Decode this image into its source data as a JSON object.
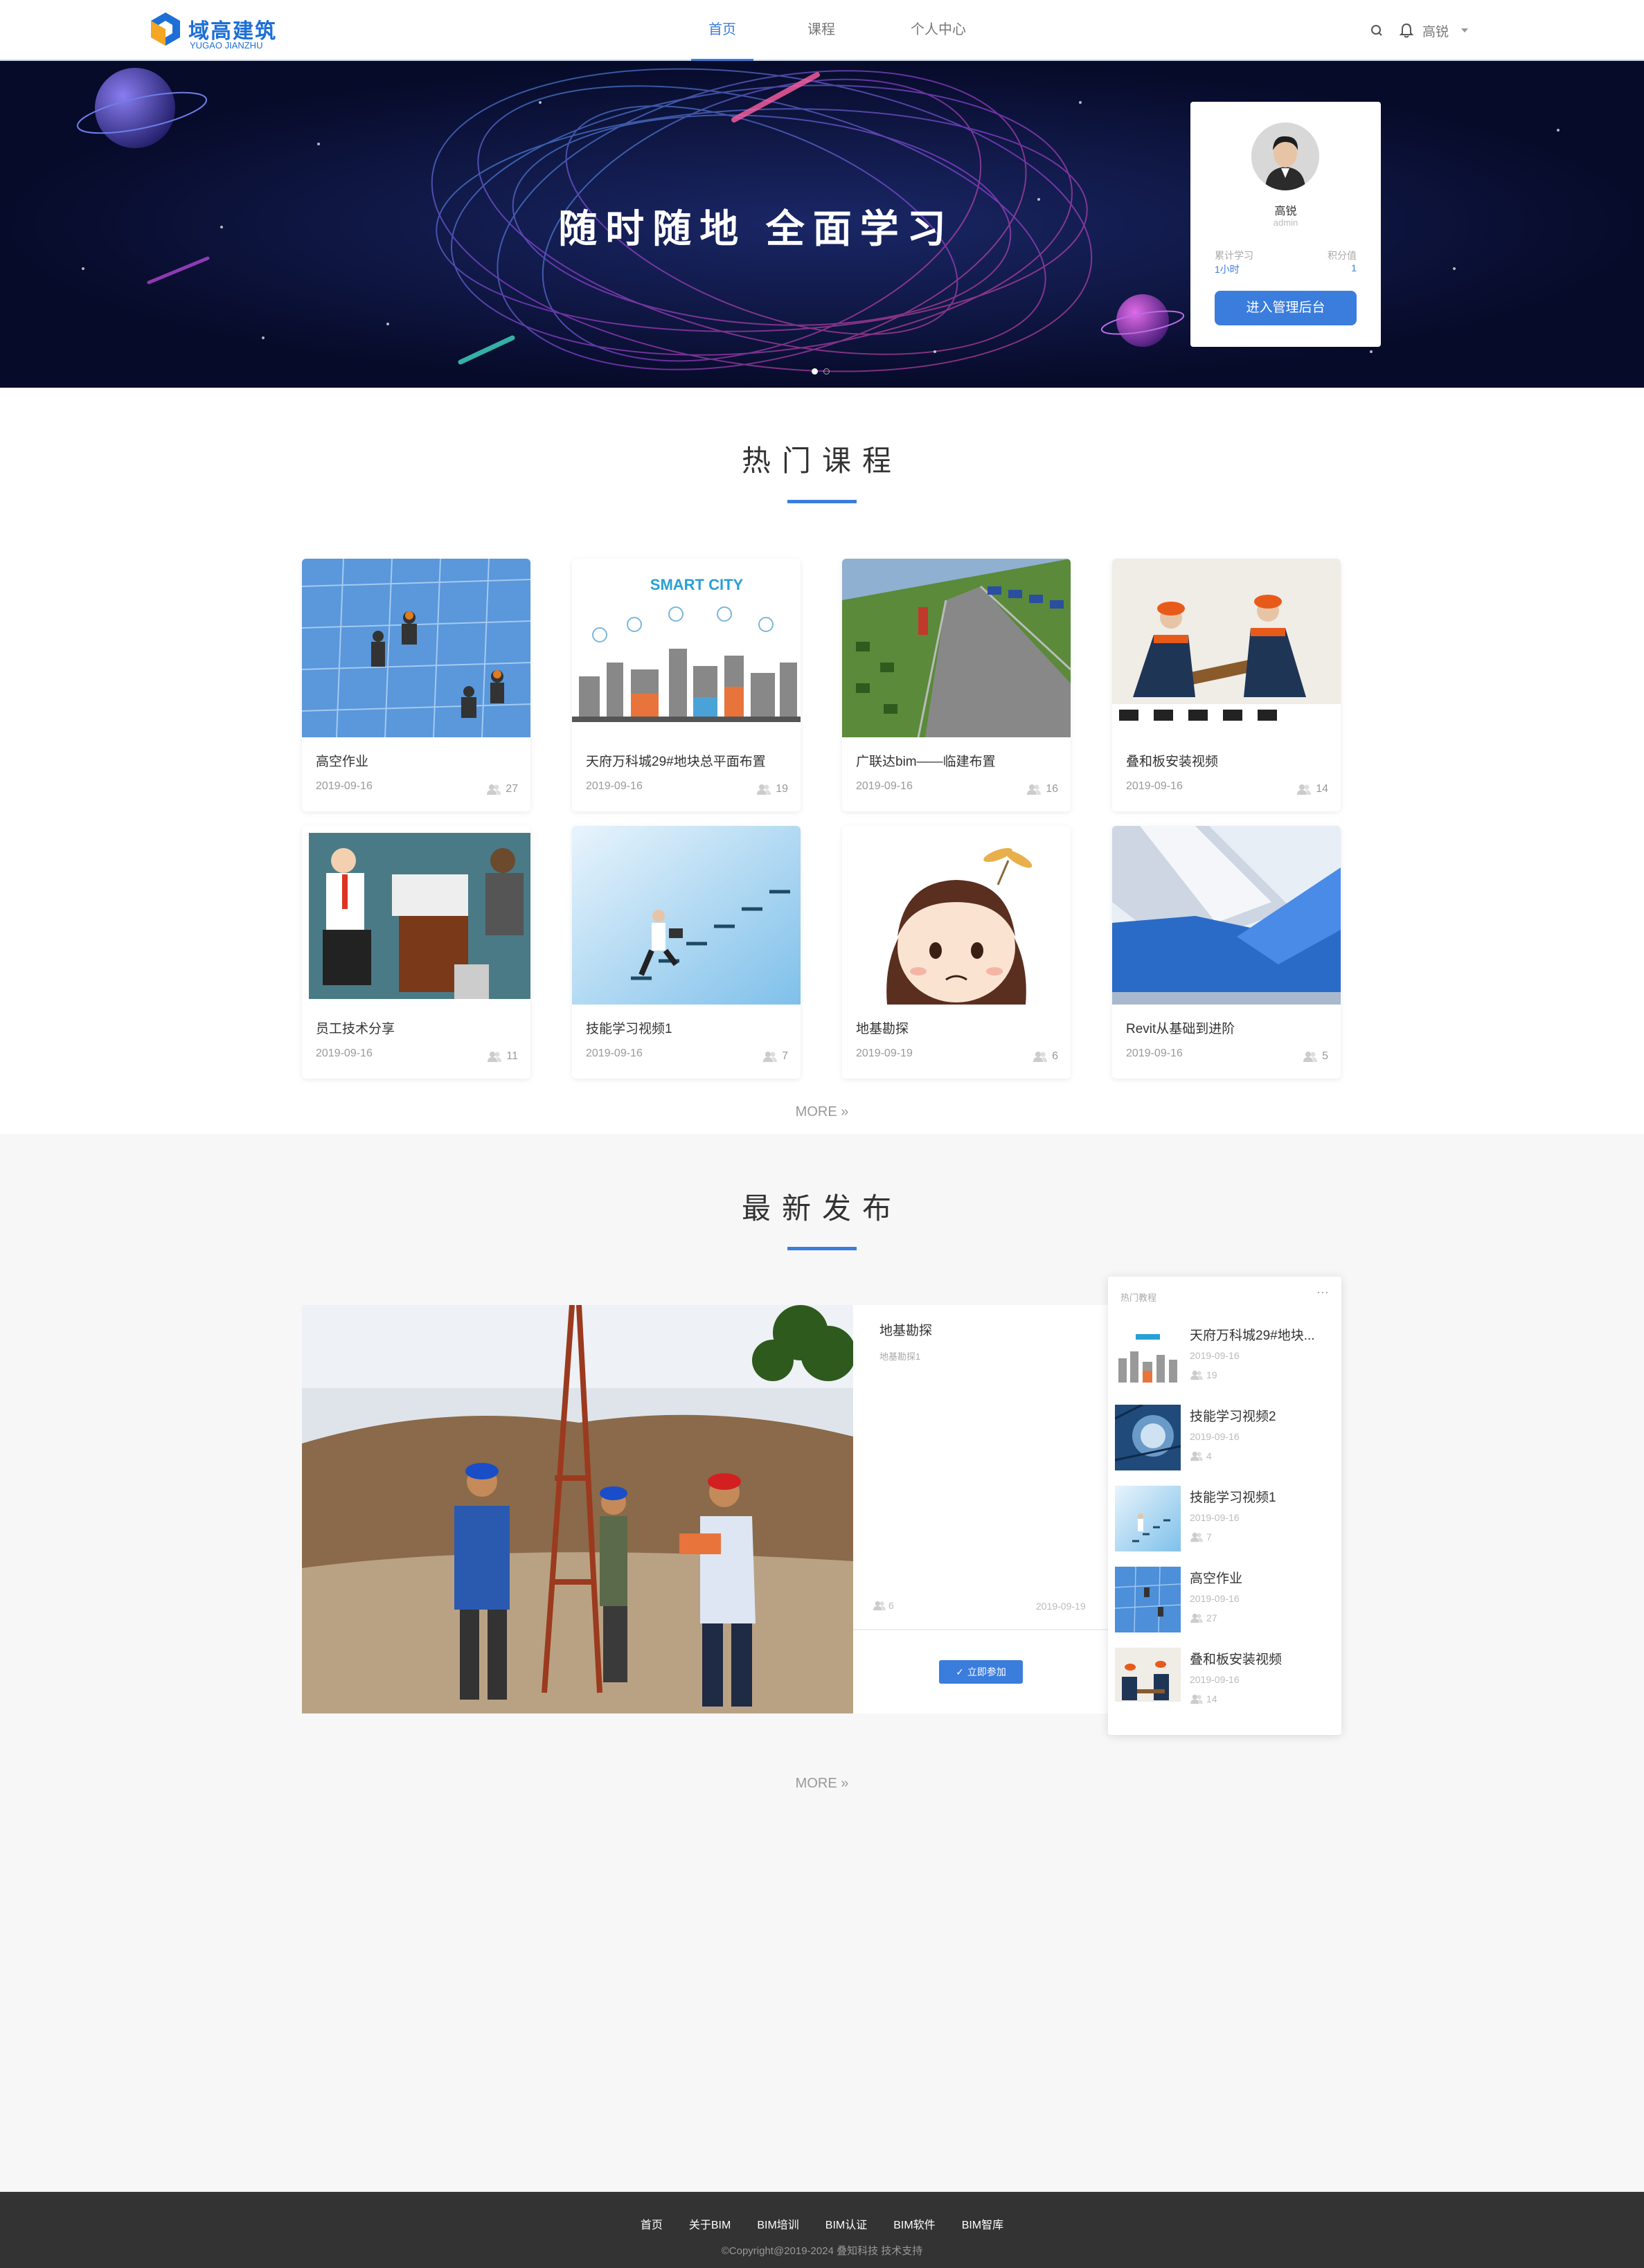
{
  "header": {
    "logo_cn": "域高建筑",
    "logo_en": "YUGAO JIANZHU",
    "nav": [
      "首页",
      "课程",
      "个人中心"
    ],
    "user": "高锐"
  },
  "hero": {
    "title": "随时随地  全面学习",
    "profile": {
      "name": "高锐",
      "role": "admin",
      "stat1_label": "累计学习",
      "stat1_value": "1小时",
      "stat2_label": "积分值",
      "stat2_value": "1",
      "button": "进入管理后台"
    }
  },
  "hot_section": {
    "title": "热门课程",
    "more": "MORE",
    "courses": [
      {
        "title": "高空作业",
        "date": "2019-09-16",
        "count": "27"
      },
      {
        "title": "天府万科城29#地块总平面布置",
        "date": "2019-09-16",
        "count": "19"
      },
      {
        "title": "广联达bim——临建布置",
        "date": "2019-09-16",
        "count": "16"
      },
      {
        "title": "叠和板安装视频",
        "date": "2019-09-16",
        "count": "14"
      },
      {
        "title": "员工技术分享",
        "date": "2019-09-16",
        "count": "11"
      },
      {
        "title": "技能学习视频1",
        "date": "2019-09-16",
        "count": "7"
      },
      {
        "title": "地基勘探",
        "date": "2019-09-19",
        "count": "6"
      },
      {
        "title": "Revit从基础到进阶",
        "date": "2019-09-16",
        "count": "5"
      }
    ],
    "smart_city_text": "SMART CITY"
  },
  "latest_section": {
    "title": "最新发布",
    "more": "MORE",
    "featured": {
      "title": "地基勘探",
      "subtitle": "地基勘探1",
      "count": "6",
      "date": "2019-09-19",
      "button": "立即参加"
    },
    "hot_list": {
      "title": "热门教程",
      "menu": "···",
      "items": [
        {
          "title": "天府万科城29#地块...",
          "date": "2019-09-16",
          "count": "19"
        },
        {
          "title": "技能学习视频2",
          "date": "2019-09-16",
          "count": "4"
        },
        {
          "title": "技能学习视频1",
          "date": "2019-09-16",
          "count": "7"
        },
        {
          "title": "高空作业",
          "date": "2019-09-16",
          "count": "27"
        },
        {
          "title": "叠和板安装视频",
          "date": "2019-09-16",
          "count": "14"
        }
      ]
    }
  },
  "footer": {
    "links": [
      "首页",
      "关于BIM",
      "BIM培训",
      "BIM认证",
      "BIM软件",
      "BIM智库"
    ],
    "copyright": "©Copyright@2019-2024 叠知科技 技术支持"
  },
  "colors": {
    "accent": "#3b7ddd",
    "footer": "#333333",
    "hero_bg": "#0a1033"
  }
}
